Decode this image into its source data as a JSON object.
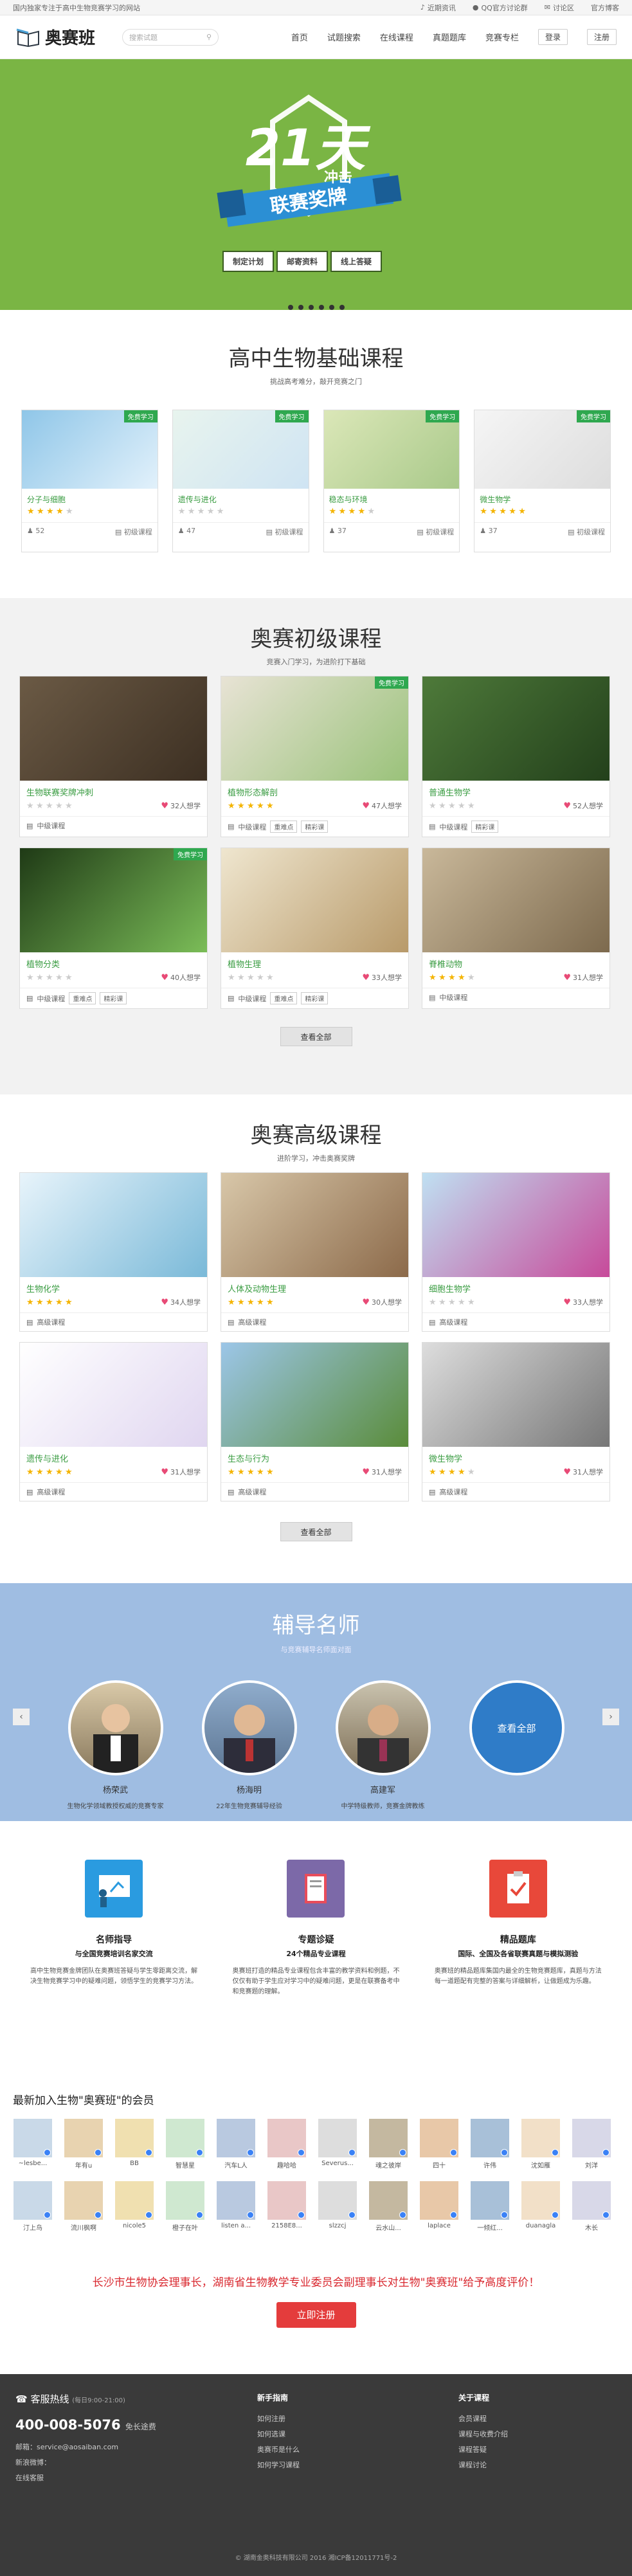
{
  "topbar": {
    "slogan": "国内独家专注于高中生物竞赛学习的网站",
    "links": [
      "近期资讯",
      "QQ官方讨论群",
      "讨论区",
      "官方博客"
    ]
  },
  "header": {
    "logo": "奥赛班",
    "search_placeholder": "搜索试题",
    "nav": [
      "首页",
      "试题搜索",
      "在线课程",
      "真题题库",
      "竞赛专栏"
    ],
    "login": "登录",
    "register": "注册"
  },
  "banner": {
    "big": "21天",
    "sub": "冲击",
    "ribbon": "联赛奖牌",
    "steps": [
      "制定计划",
      "邮寄资料",
      "线上答疑"
    ]
  },
  "basic": {
    "title": "高中生物基础课程",
    "subtitle": "挑战高考难分，敲开竞赛之门",
    "free_label": "免费学习",
    "cards": [
      {
        "name": "分子与细胞",
        "stars": 4,
        "count": "52",
        "level": "初级课程"
      },
      {
        "name": "遗传与进化",
        "stars": 0,
        "count": "47",
        "level": "初级课程"
      },
      {
        "name": "稳态与环境",
        "stars": 4,
        "count": "37",
        "level": "初级课程"
      },
      {
        "name": "微生物学",
        "stars": 5,
        "count": "37",
        "level": "初级课程"
      }
    ]
  },
  "junior": {
    "title": "奥赛初级课程",
    "subtitle": "竞赛入门学习，为进阶打下基础",
    "free_label": "免费学习",
    "view_all": "查看全部",
    "cards": [
      {
        "name": "生物联赛奖牌冲刺",
        "stars": 0,
        "count": "32人想学",
        "tags": [
          "中级课程"
        ]
      },
      {
        "name": "植物形态解剖",
        "stars": 5,
        "count": "47人想学",
        "tags": [
          "中级课程",
          "重难点",
          "精彩课"
        ]
      },
      {
        "name": "普通生物学",
        "stars": 0,
        "count": "52人想学",
        "tags": [
          "中级课程",
          "精彩课"
        ]
      },
      {
        "name": "植物分类",
        "stars": 0,
        "count": "40人想学",
        "tags": [
          "中级课程",
          "重难点",
          "精彩课"
        ]
      },
      {
        "name": "植物生理",
        "stars": 0,
        "count": "33人想学",
        "tags": [
          "中级课程",
          "重难点",
          "精彩课"
        ]
      },
      {
        "name": "脊椎动物",
        "stars": 4,
        "count": "31人想学",
        "tags": [
          "中级课程"
        ]
      }
    ]
  },
  "senior": {
    "title": "奥赛高级课程",
    "subtitle": "进阶学习，冲击奥赛奖牌",
    "view_all": "查看全部",
    "cards": [
      {
        "name": "生物化学",
        "stars": 5,
        "count": "34人想学",
        "tags": [
          "高级课程"
        ]
      },
      {
        "name": "人体及动物生理",
        "stars": 5,
        "count": "30人想学",
        "tags": [
          "高级课程"
        ]
      },
      {
        "name": "细胞生物学",
        "stars": 0,
        "count": "33人想学",
        "tags": [
          "高级课程"
        ]
      },
      {
        "name": "遗传与进化",
        "stars": 5,
        "count": "31人想学",
        "tags": [
          "高级课程"
        ]
      },
      {
        "name": "生态与行为",
        "stars": 5,
        "count": "31人想学",
        "tags": [
          "高级课程"
        ]
      },
      {
        "name": "微生物学",
        "stars": 4,
        "count": "31人想学",
        "tags": [
          "高级课程"
        ]
      }
    ]
  },
  "teachers": {
    "title": "辅导名师",
    "subtitle": "与竞赛辅导名师面对面",
    "view_all": "查看全部",
    "list": [
      {
        "name": "杨荣武",
        "desc": "生物化学领域教授权威的竞赛专家"
      },
      {
        "name": "杨海明",
        "desc": "22年生物竞赛辅导经验"
      },
      {
        "name": "高建军",
        "desc": "中学特级教师，竞赛金牌教练"
      }
    ]
  },
  "features": [
    {
      "title": "名师指导",
      "sub": "与全国竞赛培训名家交流",
      "text": "高中生物竞赛金牌团队在奥赛班答疑与学生零距离交流，解决生物竞赛学习中的疑难问题，领悟学生的竞赛学习方法。"
    },
    {
      "title": "专题诊疑",
      "sub": "24个精品专业课程",
      "text": "奥赛班打造的精品专业课程包含丰富的教学资料和例题，不仅仅有助于学生应对学习中的疑难问题，更是在联赛备考中和竞赛题的理解。"
    },
    {
      "title": "精品题库",
      "sub": "国际、全国及各省联赛真题与模拟测验",
      "text": "奥赛班的精品题库集国内最全的生物竞赛题库，真题与方法每一道题配有完整的答案与详细解析，让做题成为乐趣。"
    }
  ],
  "members": {
    "title": "最新加入生物\"奥赛班\"的会员",
    "names": [
      "~lesbe...",
      "年有u",
      "BB",
      "智慧星",
      "汽车L人",
      "趣哈哈",
      "Severus...",
      "魂之彼岸",
      "四十",
      "许伟",
      "沈如雁",
      "刘洋",
      "汀上鸟",
      "流川枫啊",
      "nicole5",
      "橙子在叶",
      "listen a...",
      "2158E8...",
      "slzzcj",
      "云水山...",
      "laplace",
      "一倾红...",
      "duanagla",
      "木长"
    ]
  },
  "cta": {
    "quote": "长沙市生物协会理事长，湖南省生物教学专业委员会副理事长对生物\"奥赛班\"给予高度评价！",
    "register": "立即注册"
  },
  "footer": {
    "hotline_label": "客服热线",
    "hours": "(每日9:00-21:00)",
    "phone": "400-008-5076",
    "phone_note": "免长途费",
    "email": "邮箱：service@aosaiban.com",
    "weibo": "新浪微博：",
    "forum": "在线客服",
    "col1": {
      "title": "新手指南",
      "items": [
        "如何注册",
        "如何选课",
        "奥赛币是什么",
        "如何学习课程"
      ]
    },
    "col2": {
      "title": "关于课程",
      "items": [
        "会员课程",
        "课程与收费介绍",
        "课程答疑",
        "课程讨论"
      ]
    },
    "copyright": "© 湖南金奥科技有限公司 2016 湘ICP备12011771号-2"
  }
}
